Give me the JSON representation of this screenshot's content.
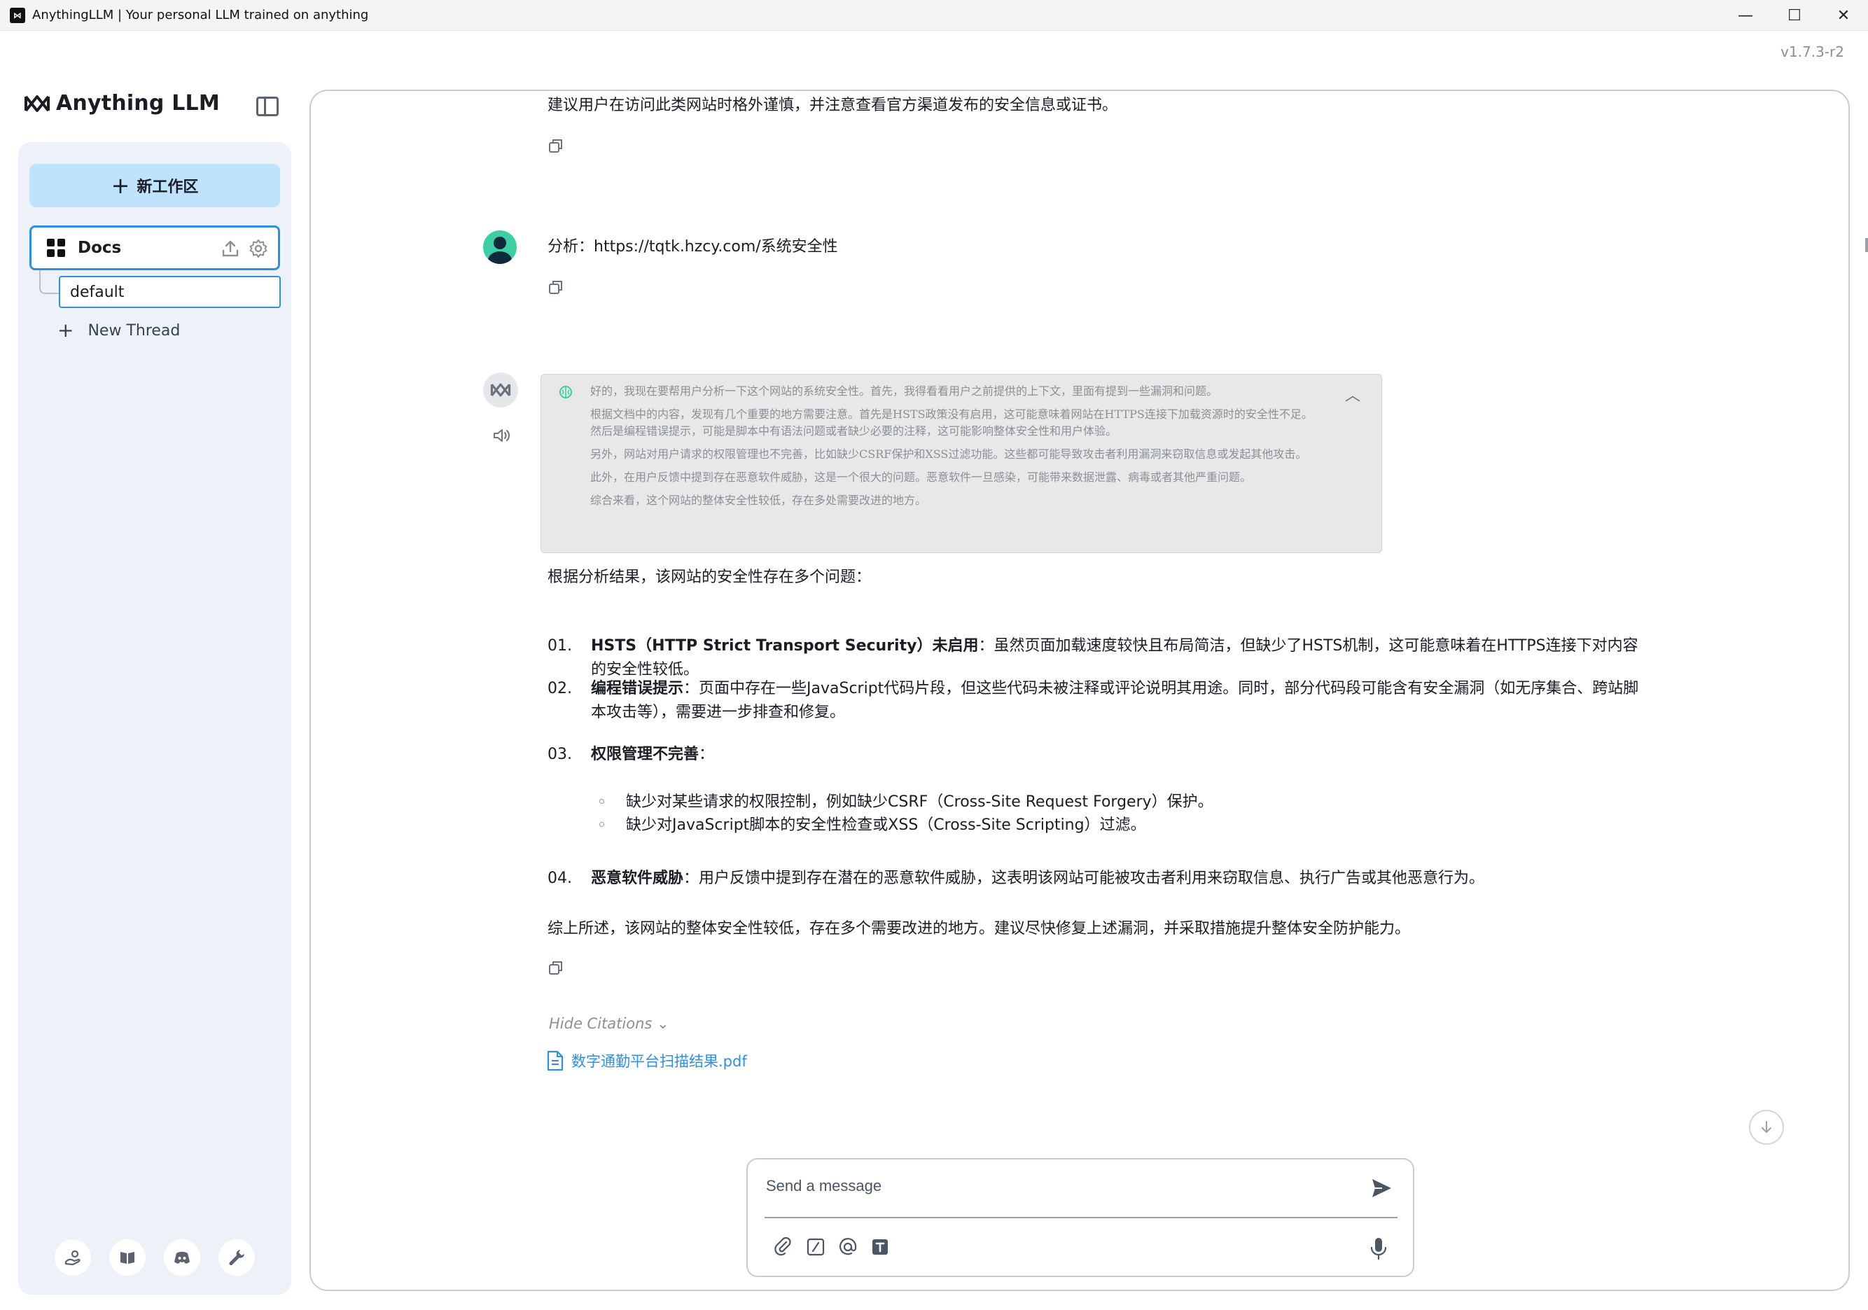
{
  "window": {
    "title": "AnythingLLM | Your personal LLM trained on anything",
    "logo_glyph": "⋈",
    "controls": {
      "minimize": "—",
      "maximize": "☐",
      "close": "✕"
    }
  },
  "version": "v1.7.3-r2",
  "sidebar": {
    "brand": "Anything LLM",
    "new_workspace_label": "新工作区",
    "workspace": {
      "name": "Docs"
    },
    "thread": {
      "name": "default"
    },
    "new_thread_label": "New Thread",
    "bottom_icons": [
      "community-hub-icon",
      "docs-book-icon",
      "discord-icon",
      "settings-wrench-icon"
    ]
  },
  "chat": {
    "prev_tail": "建议用户在访问此类网站时格外谨慎，并注意查看官方渠道发布的安全信息或证书。",
    "user_message": "分析：https://tqtk.hzcy.com/系统安全性",
    "thought": [
      "好的，我现在要帮用户分析一下这个网站的系统安全性。首先，我得看看用户之前提供的上下文，里面有提到一些漏洞和问题。",
      "根据文档中的内容，发现有几个重要的地方需要注意。首先是HSTS政策没有启用，这可能意味着网站在HTTPS连接下加载资源时的安全性不足。然后是编程错误提示，可能是脚本中有语法问题或者缺少必要的注释，这可能影响整体安全性和用户体验。",
      "另外，网站对用户请求的权限管理也不完善，比如缺少CSRF保护和XSS过滤功能。这些都可能导致攻击者利用漏洞来窃取信息或发起其他攻击。",
      "此外，在用户反馈中提到存在恶意软件威胁，这是一个很大的问题。恶意软件一旦感染，可能带来数据泄露、病毒或者其他严重问题。",
      "综合来看，这个网站的整体安全性较低，存在多处需要改进的地方。"
    ],
    "intro": "根据分析结果，该网站的安全性存在多个问题：",
    "items": [
      {
        "num": "01.",
        "title": "HSTS（HTTP Strict Transport Security）未启用",
        "text": "：虽然页面加载速度较快且布局简洁，但缺少了HSTS机制，这可能意味着在HTTPS连接下对内容的安全性较低。"
      },
      {
        "num": "02.",
        "title": "编程错误提示",
        "text": "：页面中存在一些JavaScript代码片段，但这些代码未被注释或评论说明其用途。同时，部分代码段可能含有安全漏洞（如无序集合、跨站脚本攻击等），需要进一步排查和修复。"
      },
      {
        "num": "03.",
        "title": "权限管理不完善",
        "text": "："
      },
      {
        "num": "04.",
        "title": "恶意软件威胁",
        "text": "：用户反馈中提到存在潜在的恶意软件威胁，这表明该网站可能被攻击者利用来窃取信息、执行广告或其他恶意行为。"
      }
    ],
    "sub_bullets": [
      "缺少对某些请求的权限控制，例如缺少CSRF（Cross-Site Request Forgery）保护。",
      "缺少对JavaScript脚本的安全性检查或XSS（Cross-Site Scripting）过滤。"
    ],
    "conclusion": "综上所述，该网站的整体安全性较低，存在多个需要改进的地方。建议尽快修复上述漏洞，并采取措施提升整体安全防护能力。",
    "hide_citations": "Hide Citations",
    "citation_file": "数字通勤平台扫描结果.pdf"
  },
  "composer": {
    "placeholder": "Send a message"
  },
  "colors": {
    "accent": "#2f8fe6",
    "new_workspace_bg": "#bfe3fb",
    "sidebar_bg": "#edf2f8",
    "thought_bg": "#e8e8e8"
  }
}
